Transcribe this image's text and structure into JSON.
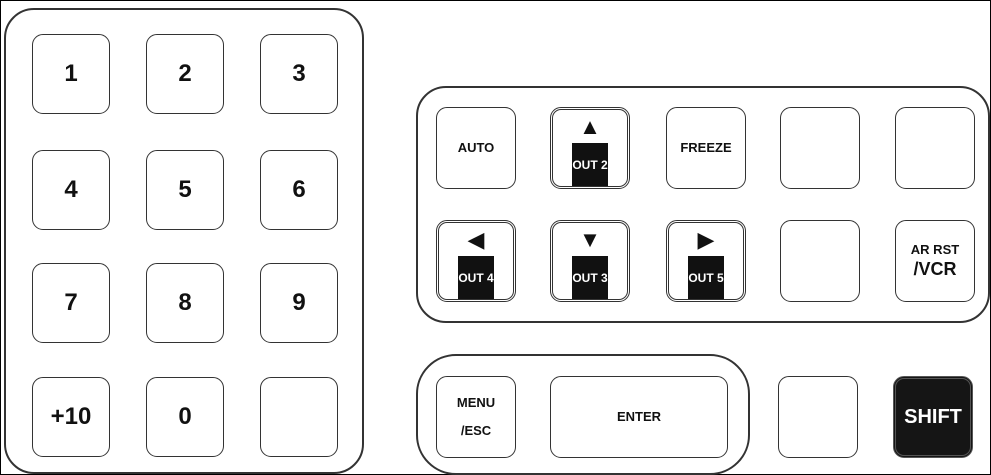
{
  "keypad": {
    "k1": "1",
    "k2": "2",
    "k3": "3",
    "k4": "4",
    "k5": "5",
    "k6": "6",
    "k7": "7",
    "k8": "8",
    "k9": "9",
    "kplus10": "+10",
    "k0": "0"
  },
  "nav": {
    "auto": "AUTO",
    "freeze": "FREEZE",
    "up_out": "OUT 2",
    "left_out": "OUT 4",
    "down_out": "OUT 3",
    "right_out": "OUT 5",
    "ar_rst_line1": "AR RST",
    "ar_rst_line2": "/VCR"
  },
  "menu": {
    "menu_line1": "MENU",
    "menu_line2": "/ESC",
    "enter": "ENTER",
    "shift": "SHIFT"
  },
  "icons": {
    "up": "▲",
    "down": "▼",
    "left": "◀",
    "right": "▶"
  }
}
